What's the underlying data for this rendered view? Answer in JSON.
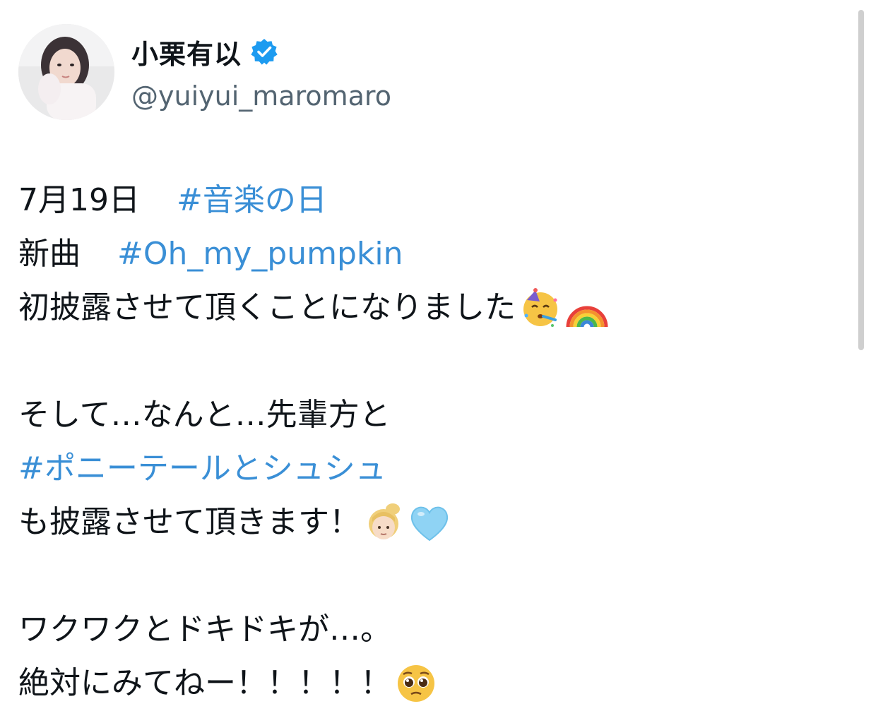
{
  "user": {
    "display_name": "小栗有以",
    "handle": "@yuiyui_maromaro",
    "verified": true
  },
  "tweet": {
    "line1_text": "7月19日",
    "line1_hashtag": "#音楽の日",
    "line2_text": "新曲",
    "line2_hashtag": "#Oh_my_pumpkin",
    "line3_text": "初披露させて頂くことになりました",
    "line3_emojis": [
      "partying-face-emoji",
      "rainbow-emoji"
    ],
    "line4_text": "そして…なんと…先輩方と",
    "line5_hashtag": "#ポニーテールとシュシュ",
    "line6_text": "も披露させて頂きます！",
    "line6_emojis": [
      "ponytail-woman-emoji",
      "light-blue-heart-emoji"
    ],
    "line7_text": "ワクワクとドキドキが…。",
    "line8_text": "絶対にみてねー！！！！！",
    "line8_emojis": [
      "pleading-face-emoji"
    ]
  },
  "colors": {
    "hashtag": "#3a8fd6",
    "handle": "#536471",
    "verified": "#1d9bf0",
    "text": "#0f1419"
  }
}
